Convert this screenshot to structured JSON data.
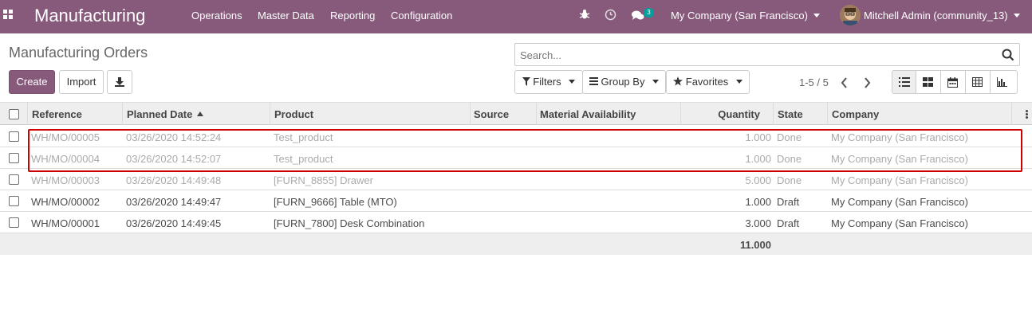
{
  "navbar": {
    "app_name": "Manufacturing",
    "menus": [
      "Operations",
      "Master Data",
      "Reporting",
      "Configuration"
    ],
    "message_count": "3",
    "company": "My Company (San Francisco)",
    "user": "Mitchell Admin (community_13)",
    "color": "#875a7b"
  },
  "page": {
    "title": "Manufacturing Orders",
    "search_placeholder": "Search...",
    "create_label": "Create",
    "import_label": "Import",
    "filters_label": "Filters",
    "groupby_label": "Group By",
    "favorites_label": "Favorites",
    "pager": "1-5 / 5"
  },
  "table": {
    "headers": {
      "reference": "Reference",
      "planned_date": "Planned Date",
      "product": "Product",
      "source": "Source",
      "material": "Material Availability",
      "quantity": "Quantity",
      "state": "State",
      "company": "Company"
    },
    "rows": [
      {
        "reference": "WH/MO/00005",
        "date": "03/26/2020 14:52:24",
        "product": "Test_product",
        "source": "",
        "material": "",
        "quantity": "1.000",
        "state": "Done",
        "company": "My Company (San Francisco)"
      },
      {
        "reference": "WH/MO/00004",
        "date": "03/26/2020 14:52:07",
        "product": "Test_product",
        "source": "",
        "material": "",
        "quantity": "1.000",
        "state": "Done",
        "company": "My Company (San Francisco)"
      },
      {
        "reference": "WH/MO/00003",
        "date": "03/26/2020 14:49:48",
        "product": "[FURN_8855] Drawer",
        "source": "",
        "material": "",
        "quantity": "5.000",
        "state": "Done",
        "company": "My Company (San Francisco)"
      },
      {
        "reference": "WH/MO/00002",
        "date": "03/26/2020 14:49:47",
        "product": "[FURN_9666] Table (MTO)",
        "source": "",
        "material": "",
        "quantity": "1.000",
        "state": "Draft",
        "company": "My Company (San Francisco)"
      },
      {
        "reference": "WH/MO/00001",
        "date": "03/26/2020 14:49:45",
        "product": "[FURN_7800] Desk Combination",
        "source": "",
        "material": "",
        "quantity": "3.000",
        "state": "Draft",
        "company": "My Company (San Francisco)"
      }
    ],
    "total_quantity": "11.000"
  }
}
